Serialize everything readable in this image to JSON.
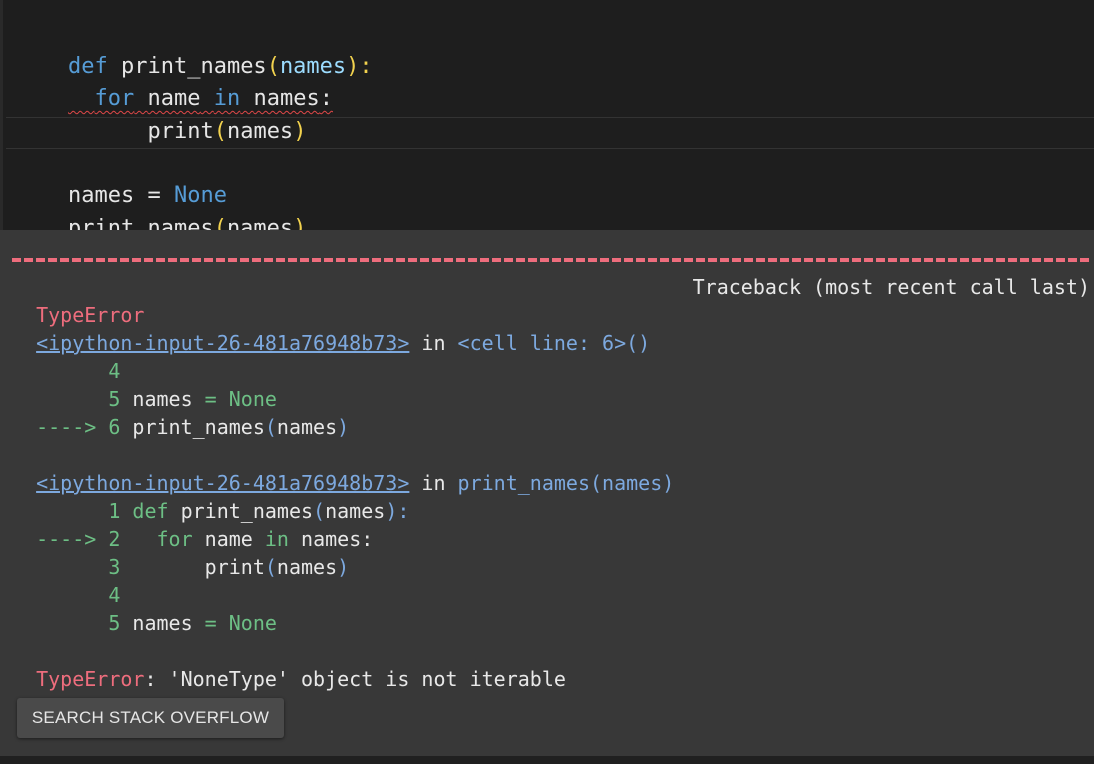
{
  "code_cell": {
    "lines": [
      [
        "def",
        " ",
        "print_names",
        "(",
        "names",
        "):"
      ],
      [
        "  ",
        "for",
        " ",
        "name",
        " ",
        "in",
        " ",
        "names",
        ":"
      ],
      [
        "      ",
        "print",
        "(",
        "names",
        ")"
      ],
      [
        ""
      ],
      [
        "names",
        " = ",
        "None"
      ],
      [
        "print_names",
        "(",
        "names",
        ")"
      ]
    ]
  },
  "output": {
    "error_type": "TypeError",
    "traceback_header": "Traceback (most recent call last)",
    "frame1": {
      "link": "<ipython-input-26-481a76948b73>",
      "in_text": " in ",
      "location": "<cell line: 6>()",
      "lines": {
        "l4_num": "      4",
        "l5_num": "      5 ",
        "l5_var": "names",
        "l5_eq": " = ",
        "l5_val": "None",
        "arrow": "----> 6 ",
        "l6_fn": "print_names",
        "l6_open": "(",
        "l6_arg": "names",
        "l6_close": ")"
      }
    },
    "frame2": {
      "link": "<ipython-input-26-481a76948b73>",
      "in_text": " in ",
      "location": "print_names(names)",
      "lines": {
        "l1_num": "      1 ",
        "l1_kw": "def",
        "l1_fn": " print_names",
        "l1_open": "(",
        "l1_arg": "names",
        "l1_close": "):",
        "arrow": "----> 2 ",
        "l2_kw": "  for",
        "l2_var": " name ",
        "l2_in": "in",
        "l2_rest": " names:",
        "l3_num": "      3 ",
        "l3_fn": "      print",
        "l3_open": "(",
        "l3_arg": "names",
        "l3_close": ")",
        "l4_num": "      4",
        "l5_num": "      5 ",
        "l5_var": "names",
        "l5_eq": " = ",
        "l5_val": "None"
      }
    },
    "error_message": ": 'NoneType' object is not iterable"
  },
  "button": {
    "label": "SEARCH STACK OVERFLOW"
  },
  "colors": {
    "code_bg": "#1e1e1e",
    "output_bg": "#383838",
    "error_red": "#ee6d7d",
    "line_green": "#6dbf85",
    "link_blue": "#7da9df",
    "keyword_blue": "#569cd6",
    "paren_yellow": "#f2d24e"
  }
}
